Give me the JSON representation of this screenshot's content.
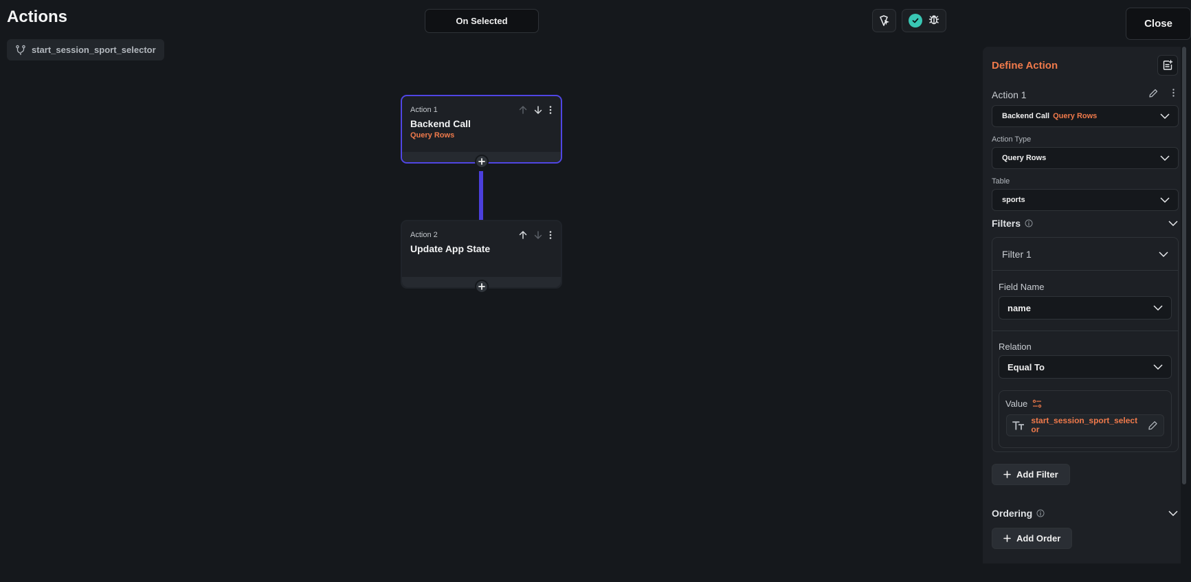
{
  "header": {
    "title": "Actions",
    "trigger_label": "On Selected",
    "close_label": "Close"
  },
  "widget": {
    "name": "start_session_sport_selector"
  },
  "flow": {
    "actions": [
      {
        "label": "Action 1",
        "title": "Backend Call",
        "subtitle": "Query Rows"
      },
      {
        "label": "Action 2",
        "title": "Update App State",
        "subtitle": ""
      }
    ]
  },
  "panel": {
    "heading": "Define Action",
    "action_name": "Action 1",
    "action_select": {
      "primary": "Backend Call",
      "secondary": "Query Rows"
    },
    "action_type_label": "Action Type",
    "action_type_value": "Query Rows",
    "table_label": "Table",
    "table_value": "sports",
    "filters_label": "Filters",
    "filter": {
      "title": "Filter 1",
      "field_name_label": "Field Name",
      "field_name_value": "name",
      "relation_label": "Relation",
      "relation_value": "Equal To",
      "value_label": "Value",
      "value_text": "start_session_sport_selector"
    },
    "add_filter_label": "Add Filter",
    "ordering_label": "Ordering",
    "add_order_label": "Add Order"
  },
  "colors": {
    "accent_orange": "#f07a4b",
    "selection_purple": "#5046e4",
    "success_teal": "#39c7b4",
    "background": "#15181c"
  }
}
